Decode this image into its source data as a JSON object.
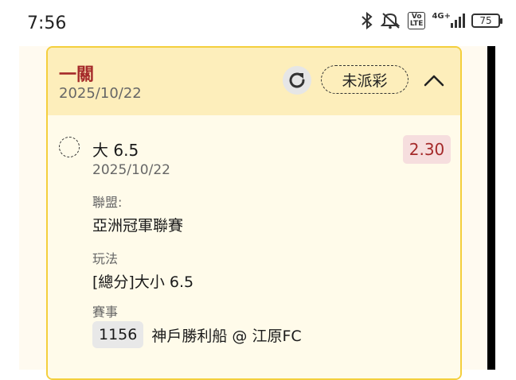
{
  "status_bar": {
    "time": "7:56",
    "network": "4G+",
    "volte_label": "Vo\nLTE",
    "battery": "75"
  },
  "card": {
    "bet_type": "一關",
    "date": "2025/10/22",
    "status_label": "未派彩",
    "selection": {
      "label": "大 6.5",
      "date": "2025/10/22",
      "odds": "2.30"
    },
    "league_label": "聯盟:",
    "league_value": "亞洲冠軍聯賽",
    "market_label": "玩法",
    "market_value": "[總分]大小 6.5",
    "event_label": "賽事",
    "event_id": "1156",
    "event_name": "神戶勝利船 @ 江原FC"
  },
  "colors": {
    "accent_border": "#f4cf3d",
    "header_bg": "#fdeebb",
    "bet_type": "#a52a2a",
    "odds_bg": "#f6dede"
  },
  "icons": [
    "bluetooth-icon",
    "mute-icon",
    "volte-icon",
    "signal-icon",
    "battery-icon",
    "refresh-icon",
    "chevron-up-icon",
    "radio-unchecked-icon"
  ]
}
